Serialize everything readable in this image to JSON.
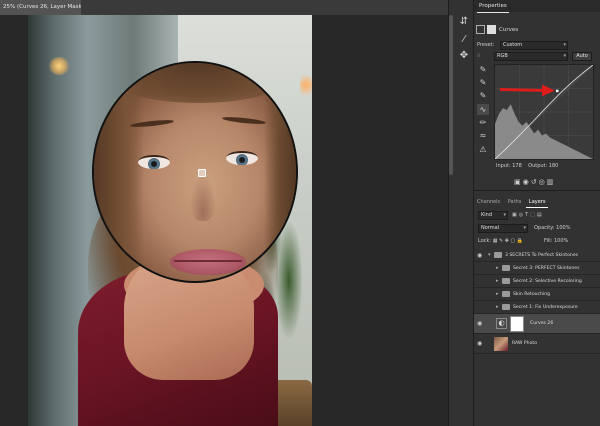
{
  "document": {
    "tab_title": "25% (Curves 26, Layer Mask/8) *"
  },
  "properties": {
    "panel_title": "Properties",
    "adjustment_name": "Curves",
    "preset_label": "Preset:",
    "preset_value": "Custom",
    "channel_value": "RGB",
    "auto_label": "Auto",
    "input_label": "Input:",
    "input_value": "178",
    "output_label": "Output:",
    "output_value": "180"
  },
  "layers": {
    "tabs": [
      "Channels",
      "Paths",
      "Layers"
    ],
    "active_tab": "Layers",
    "filter_value": "Kind",
    "blend_mode": "Normal",
    "opacity_label": "Opacity:",
    "opacity_value": "100%",
    "lock_label": "Lock:",
    "fill_label": "Fill:",
    "fill_value": "100%",
    "rows": [
      {
        "name": "3 SECRETS To Perfect Skintones",
        "type": "group",
        "indent": 0
      },
      {
        "name": "Secret 3: PERFECT Skintones",
        "type": "group",
        "indent": 1
      },
      {
        "name": "Secret 2: Selective Recoloring",
        "type": "group",
        "indent": 1
      },
      {
        "name": "Skin Retouching",
        "type": "group",
        "indent": 1
      },
      {
        "name": "Secret 1: Fix Underexposure",
        "type": "group",
        "indent": 1
      },
      {
        "name": "Curves 26",
        "type": "adjustment",
        "indent": 1,
        "selected": true
      },
      {
        "name": "RAW Photo",
        "type": "image",
        "indent": 0
      }
    ]
  },
  "colors": {
    "arrow": "#e01b1b",
    "panel_bg": "#323232",
    "canvas_bg": "#282828"
  },
  "icons": [
    "curves-icon",
    "layer-mask-icon",
    "eyedropper-icon",
    "pencil-icon",
    "eye-icon",
    "folder-icon"
  ]
}
